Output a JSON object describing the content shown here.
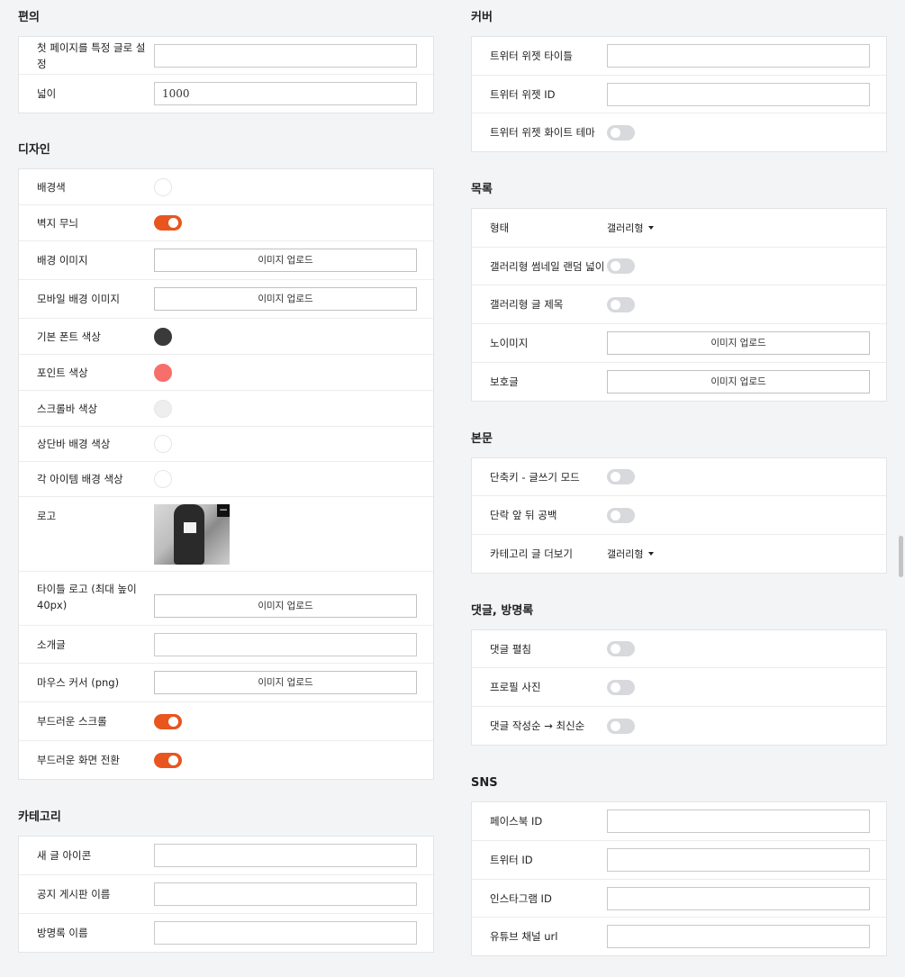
{
  "upload_label": "이미지 업로드",
  "colors": {
    "accent": "#e8551f",
    "toggle_off": "#d7d9dc",
    "swatch_font": "#3a3a3a",
    "swatch_point": "#f76f6a",
    "swatch_scrollbar": "#eeeeee",
    "swatch_white": "#ffffff"
  },
  "left": {
    "convenience": {
      "title": "편의",
      "first_page_label": "첫 페이지를 특정 글로 설정",
      "first_page_value": "",
      "width_label": "넓이",
      "width_value": "1000"
    },
    "design": {
      "title": "디자인",
      "bg_color_label": "배경색",
      "wallpaper_label": "벽지 무늬",
      "bg_image_label": "배경 이미지",
      "mobile_bg_label": "모바일 배경 이미지",
      "font_color_label": "기본 폰트 색상",
      "point_color_label": "포인트 색상",
      "scrollbar_color_label": "스크롤바 색상",
      "topbar_color_label": "상단바 배경 색상",
      "item_bg_label": "각 아이템 배경 색상",
      "logo_label": "로고",
      "title_logo_label": "타이틀 로고 (최대 높이 40px)",
      "intro_label": "소개글",
      "intro_value": "",
      "cursor_label": "마우스 커서 (png)",
      "smooth_scroll_label": "부드러운 스크롤",
      "smooth_transition_label": "부드러운 화면 전환"
    },
    "category": {
      "title": "카테고리",
      "new_icon_label": "새 글 아이콘",
      "notice_label": "공지 게시판 이름",
      "guestbook_label": "방명록 이름"
    }
  },
  "right": {
    "cover": {
      "title": "커버",
      "tw_title_label": "트위터 위젯 타이틀",
      "tw_id_label": "트위터 위젯 ID",
      "tw_white_label": "트위터 위젯 화이트 테마"
    },
    "list": {
      "title": "목록",
      "type_label": "형태",
      "type_value": "갤러리형",
      "random_width_label": "갤러리형 썸네일 랜덤 넓이",
      "gallery_title_label": "갤러리형 글 제목",
      "noimage_label": "노이미지",
      "protected_label": "보호글"
    },
    "body": {
      "title": "본문",
      "shortcut_label": "단축키 - 글쓰기 모드",
      "paragraph_label": "단락 앞 뒤 공백",
      "more_label": "카테고리 글 더보기",
      "more_value": "갤러리형"
    },
    "comments": {
      "title": "댓글, 방명록",
      "expand_label": "댓글 펼침",
      "profile_label": "프로필 사진",
      "order_label": "댓글 작성순 → 최신순"
    },
    "sns": {
      "title": "SNS",
      "facebook_label": "페이스북 ID",
      "twitter_label": "트위터 ID",
      "instagram_label": "인스타그램 ID",
      "youtube_label": "유튜브 채널 url"
    }
  }
}
